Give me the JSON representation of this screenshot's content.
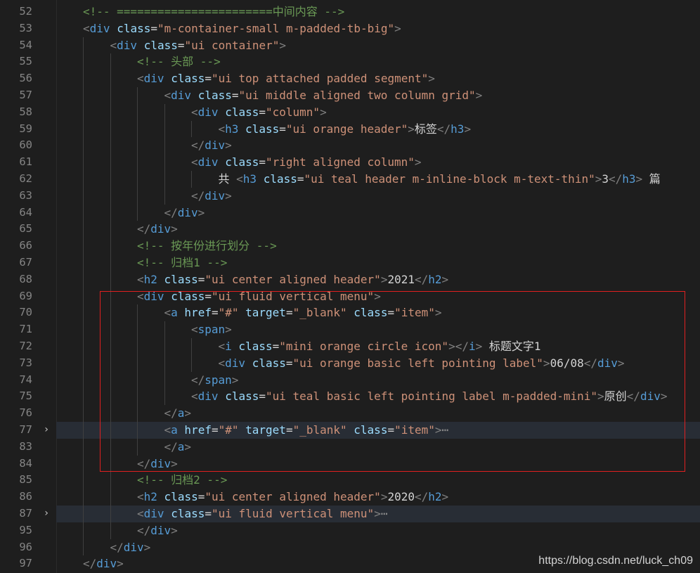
{
  "editor": {
    "lines": [
      {
        "num": "52",
        "indent": 1,
        "tokens": [
          [
            "comment",
            "<!-- =======================中间内容 -->"
          ]
        ]
      },
      {
        "num": "53",
        "indent": 1,
        "tokens": [
          [
            "bracket",
            "<"
          ],
          [
            "tag",
            "div"
          ],
          [
            "text",
            " "
          ],
          [
            "attr",
            "class"
          ],
          [
            "op",
            "="
          ],
          [
            "str",
            "\"m-container-small m-padded-tb-big\""
          ],
          [
            "bracket",
            ">"
          ]
        ]
      },
      {
        "num": "54",
        "indent": 2,
        "tokens": [
          [
            "bracket",
            "<"
          ],
          [
            "tag",
            "div"
          ],
          [
            "text",
            " "
          ],
          [
            "attr",
            "class"
          ],
          [
            "op",
            "="
          ],
          [
            "str",
            "\"ui container\""
          ],
          [
            "bracket",
            ">"
          ]
        ]
      },
      {
        "num": "55",
        "indent": 3,
        "tokens": [
          [
            "comment",
            "<!-- 头部 -->"
          ]
        ]
      },
      {
        "num": "56",
        "indent": 3,
        "tokens": [
          [
            "bracket",
            "<"
          ],
          [
            "tag",
            "div"
          ],
          [
            "text",
            " "
          ],
          [
            "attr",
            "class"
          ],
          [
            "op",
            "="
          ],
          [
            "str",
            "\"ui top attached padded segment\""
          ],
          [
            "bracket",
            ">"
          ]
        ]
      },
      {
        "num": "57",
        "indent": 4,
        "tokens": [
          [
            "bracket",
            "<"
          ],
          [
            "tag",
            "div"
          ],
          [
            "text",
            " "
          ],
          [
            "attr",
            "class"
          ],
          [
            "op",
            "="
          ],
          [
            "str",
            "\"ui middle aligned two column grid\""
          ],
          [
            "bracket",
            ">"
          ]
        ]
      },
      {
        "num": "58",
        "indent": 5,
        "tokens": [
          [
            "bracket",
            "<"
          ],
          [
            "tag",
            "div"
          ],
          [
            "text",
            " "
          ],
          [
            "attr",
            "class"
          ],
          [
            "op",
            "="
          ],
          [
            "str",
            "\"column\""
          ],
          [
            "bracket",
            ">"
          ]
        ]
      },
      {
        "num": "59",
        "indent": 6,
        "tokens": [
          [
            "bracket",
            "<"
          ],
          [
            "tag",
            "h3"
          ],
          [
            "text",
            " "
          ],
          [
            "attr",
            "class"
          ],
          [
            "op",
            "="
          ],
          [
            "str",
            "\"ui orange header\""
          ],
          [
            "bracket",
            ">"
          ],
          [
            "text",
            "标签"
          ],
          [
            "bracket",
            "</"
          ],
          [
            "tag",
            "h3"
          ],
          [
            "bracket",
            ">"
          ]
        ]
      },
      {
        "num": "60",
        "indent": 5,
        "tokens": [
          [
            "bracket",
            "</"
          ],
          [
            "tag",
            "div"
          ],
          [
            "bracket",
            ">"
          ]
        ]
      },
      {
        "num": "61",
        "indent": 5,
        "tokens": [
          [
            "bracket",
            "<"
          ],
          [
            "tag",
            "div"
          ],
          [
            "text",
            " "
          ],
          [
            "attr",
            "class"
          ],
          [
            "op",
            "="
          ],
          [
            "str",
            "\"right aligned column\""
          ],
          [
            "bracket",
            ">"
          ]
        ]
      },
      {
        "num": "62",
        "indent": 6,
        "tokens": [
          [
            "text",
            "共 "
          ],
          [
            "bracket",
            "<"
          ],
          [
            "tag",
            "h3"
          ],
          [
            "text",
            " "
          ],
          [
            "attr",
            "class"
          ],
          [
            "op",
            "="
          ],
          [
            "str",
            "\"ui teal header m-inline-block m-text-thin\""
          ],
          [
            "bracket",
            ">"
          ],
          [
            "text",
            "3"
          ],
          [
            "bracket",
            "</"
          ],
          [
            "tag",
            "h3"
          ],
          [
            "bracket",
            ">"
          ],
          [
            "text",
            " 篇"
          ]
        ]
      },
      {
        "num": "63",
        "indent": 5,
        "tokens": [
          [
            "bracket",
            "</"
          ],
          [
            "tag",
            "div"
          ],
          [
            "bracket",
            ">"
          ]
        ]
      },
      {
        "num": "64",
        "indent": 4,
        "tokens": [
          [
            "bracket",
            "</"
          ],
          [
            "tag",
            "div"
          ],
          [
            "bracket",
            ">"
          ]
        ]
      },
      {
        "num": "65",
        "indent": 3,
        "tokens": [
          [
            "bracket",
            "</"
          ],
          [
            "tag",
            "div"
          ],
          [
            "bracket",
            ">"
          ]
        ]
      },
      {
        "num": "66",
        "indent": 3,
        "tokens": [
          [
            "comment",
            "<!-- 按年份进行划分 -->"
          ]
        ]
      },
      {
        "num": "67",
        "indent": 3,
        "tokens": [
          [
            "comment",
            "<!-- 归档1 -->"
          ]
        ]
      },
      {
        "num": "68",
        "indent": 3,
        "tokens": [
          [
            "bracket",
            "<"
          ],
          [
            "tag",
            "h2"
          ],
          [
            "text",
            " "
          ],
          [
            "attr",
            "class"
          ],
          [
            "op",
            "="
          ],
          [
            "str",
            "\"ui center aligned header\""
          ],
          [
            "bracket",
            ">"
          ],
          [
            "text",
            "2021"
          ],
          [
            "bracket",
            "</"
          ],
          [
            "tag",
            "h2"
          ],
          [
            "bracket",
            ">"
          ]
        ]
      },
      {
        "num": "69",
        "indent": 3,
        "tokens": [
          [
            "bracket",
            "<"
          ],
          [
            "tag",
            "div"
          ],
          [
            "text",
            " "
          ],
          [
            "attr",
            "class"
          ],
          [
            "op",
            "="
          ],
          [
            "str",
            "\"ui fluid vertical menu\""
          ],
          [
            "bracket",
            ">"
          ]
        ]
      },
      {
        "num": "70",
        "indent": 4,
        "tokens": [
          [
            "bracket",
            "<"
          ],
          [
            "tag",
            "a"
          ],
          [
            "text",
            " "
          ],
          [
            "attr",
            "href"
          ],
          [
            "op",
            "="
          ],
          [
            "str",
            "\"#\""
          ],
          [
            "text",
            " "
          ],
          [
            "attr",
            "target"
          ],
          [
            "op",
            "="
          ],
          [
            "str",
            "\"_blank\""
          ],
          [
            "text",
            " "
          ],
          [
            "attr",
            "class"
          ],
          [
            "op",
            "="
          ],
          [
            "str",
            "\"item\""
          ],
          [
            "bracket",
            ">"
          ]
        ]
      },
      {
        "num": "71",
        "indent": 5,
        "tokens": [
          [
            "bracket",
            "<"
          ],
          [
            "tag",
            "span"
          ],
          [
            "bracket",
            ">"
          ]
        ]
      },
      {
        "num": "72",
        "indent": 6,
        "tokens": [
          [
            "bracket",
            "<"
          ],
          [
            "tag",
            "i"
          ],
          [
            "text",
            " "
          ],
          [
            "attr",
            "class"
          ],
          [
            "op",
            "="
          ],
          [
            "str",
            "\"mini orange circle icon\""
          ],
          [
            "bracket",
            "></"
          ],
          [
            "tag",
            "i"
          ],
          [
            "bracket",
            ">"
          ],
          [
            "text",
            " 标题文字1"
          ]
        ]
      },
      {
        "num": "73",
        "indent": 6,
        "tokens": [
          [
            "bracket",
            "<"
          ],
          [
            "tag",
            "div"
          ],
          [
            "text",
            " "
          ],
          [
            "attr",
            "class"
          ],
          [
            "op",
            "="
          ],
          [
            "str",
            "\"ui orange basic left pointing label\""
          ],
          [
            "bracket",
            ">"
          ],
          [
            "text",
            "06/08"
          ],
          [
            "bracket",
            "</"
          ],
          [
            "tag",
            "div"
          ],
          [
            "bracket",
            ">"
          ]
        ]
      },
      {
        "num": "74",
        "indent": 5,
        "tokens": [
          [
            "bracket",
            "</"
          ],
          [
            "tag",
            "span"
          ],
          [
            "bracket",
            ">"
          ]
        ]
      },
      {
        "num": "75",
        "indent": 5,
        "tokens": [
          [
            "bracket",
            "<"
          ],
          [
            "tag",
            "div"
          ],
          [
            "text",
            " "
          ],
          [
            "attr",
            "class"
          ],
          [
            "op",
            "="
          ],
          [
            "str",
            "\"ui teal basic left pointing label m-padded-mini\""
          ],
          [
            "bracket",
            ">"
          ],
          [
            "text",
            "原创"
          ],
          [
            "bracket",
            "</"
          ],
          [
            "tag",
            "div"
          ],
          [
            "bracket",
            ">"
          ]
        ]
      },
      {
        "num": "76",
        "indent": 4,
        "tokens": [
          [
            "bracket",
            "</"
          ],
          [
            "tag",
            "a"
          ],
          [
            "bracket",
            ">"
          ]
        ]
      },
      {
        "num": "77",
        "indent": 4,
        "fold": "›",
        "hl": true,
        "tokens": [
          [
            "bracket",
            "<"
          ],
          [
            "tag",
            "a"
          ],
          [
            "text",
            " "
          ],
          [
            "attr",
            "href"
          ],
          [
            "op",
            "="
          ],
          [
            "str",
            "\"#\""
          ],
          [
            "text",
            " "
          ],
          [
            "attr",
            "target"
          ],
          [
            "op",
            "="
          ],
          [
            "str",
            "\"_blank\""
          ],
          [
            "text",
            " "
          ],
          [
            "attr",
            "class"
          ],
          [
            "op",
            "="
          ],
          [
            "str",
            "\"item\""
          ],
          [
            "bracket",
            ">"
          ],
          [
            "ellipsis",
            "⋯"
          ]
        ]
      },
      {
        "num": "83",
        "indent": 4,
        "tokens": [
          [
            "bracket",
            "</"
          ],
          [
            "tag",
            "a"
          ],
          [
            "bracket",
            ">"
          ]
        ]
      },
      {
        "num": "84",
        "indent": 3,
        "tokens": [
          [
            "bracket",
            "</"
          ],
          [
            "tag",
            "div"
          ],
          [
            "bracket",
            ">"
          ]
        ]
      },
      {
        "num": "85",
        "indent": 3,
        "tokens": [
          [
            "comment",
            "<!-- 归档2 -->"
          ]
        ]
      },
      {
        "num": "86",
        "indent": 3,
        "tokens": [
          [
            "bracket",
            "<"
          ],
          [
            "tag",
            "h2"
          ],
          [
            "text",
            " "
          ],
          [
            "attr",
            "class"
          ],
          [
            "op",
            "="
          ],
          [
            "str",
            "\"ui center aligned header\""
          ],
          [
            "bracket",
            ">"
          ],
          [
            "text",
            "2020"
          ],
          [
            "bracket",
            "</"
          ],
          [
            "tag",
            "h2"
          ],
          [
            "bracket",
            ">"
          ]
        ]
      },
      {
        "num": "87",
        "indent": 3,
        "fold": "›",
        "hl": true,
        "tokens": [
          [
            "bracket",
            "<"
          ],
          [
            "tag",
            "div"
          ],
          [
            "text",
            " "
          ],
          [
            "attr",
            "class"
          ],
          [
            "op",
            "="
          ],
          [
            "str",
            "\"ui fluid vertical menu\""
          ],
          [
            "bracket",
            ">"
          ],
          [
            "ellipsis",
            "⋯"
          ]
        ]
      },
      {
        "num": "95",
        "indent": 3,
        "tokens": [
          [
            "bracket",
            "</"
          ],
          [
            "tag",
            "div"
          ],
          [
            "bracket",
            ">"
          ]
        ]
      },
      {
        "num": "96",
        "indent": 2,
        "tokens": [
          [
            "bracket",
            "</"
          ],
          [
            "tag",
            "div"
          ],
          [
            "bracket",
            ">"
          ]
        ]
      },
      {
        "num": "97",
        "indent": 1,
        "tokens": [
          [
            "bracket",
            "</"
          ],
          [
            "tag",
            "div"
          ],
          [
            "bracket",
            ">"
          ]
        ]
      }
    ]
  },
  "watermark": "https://blog.csdn.net/luck_ch09",
  "colors": {
    "background": "#1e1e1e",
    "tag": "#569cd6",
    "attribute": "#9cdcfe",
    "string": "#ce9178",
    "comment": "#6a9955",
    "text": "#d4d4d4",
    "bracket": "#808080",
    "selection_box": "#e02020"
  }
}
